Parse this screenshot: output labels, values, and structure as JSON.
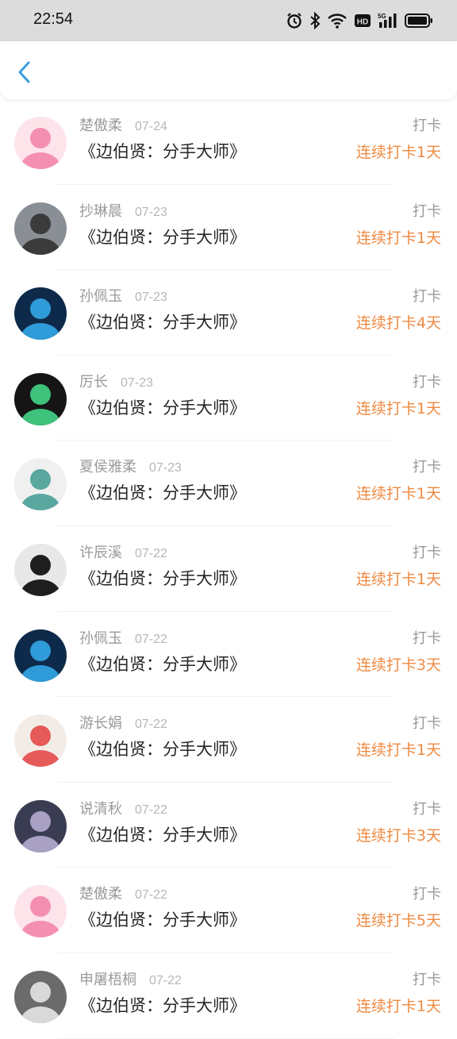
{
  "status_bar": {
    "time": "22:54",
    "icons": [
      "alarm-icon",
      "bluetooth-icon",
      "wifi-icon",
      "hd-icon",
      "5g-signal-icon",
      "battery-icon"
    ]
  },
  "nav": {
    "back_icon": "chevron-left-icon",
    "accent_color": "#3b9ee0"
  },
  "list": {
    "accent_color": "#ef8a42",
    "items": [
      {
        "user": "楚傲柔",
        "date": "07-24",
        "title": "《边伯贤：分手大师》",
        "action": "打卡",
        "streak": "连续打卡1天",
        "avatar": {
          "bg": "#fde3ea",
          "fg": "#f48fb1"
        }
      },
      {
        "user": "抄琳晨",
        "date": "07-23",
        "title": "《边伯贤：分手大师》",
        "action": "打卡",
        "streak": "连续打卡1天",
        "avatar": {
          "bg": "#8a8f95",
          "fg": "#3b3b3b"
        }
      },
      {
        "user": "孙佩玉",
        "date": "07-23",
        "title": "《边伯贤：分手大师》",
        "action": "打卡",
        "streak": "连续打卡4天",
        "avatar": {
          "bg": "#0e2a4a",
          "fg": "#2f9bd8"
        }
      },
      {
        "user": "厉长",
        "date": "07-23",
        "title": "《边伯贤：分手大师》",
        "action": "打卡",
        "streak": "连续打卡1天",
        "avatar": {
          "bg": "#151515",
          "fg": "#3fc27c"
        }
      },
      {
        "user": "夏侯雅柔",
        "date": "07-23",
        "title": "《边伯贤：分手大师》",
        "action": "打卡",
        "streak": "连续打卡1天",
        "avatar": {
          "bg": "#f0f0f0",
          "fg": "#5aa7a0"
        }
      },
      {
        "user": "许辰溪",
        "date": "07-22",
        "title": "《边伯贤：分手大师》",
        "action": "打卡",
        "streak": "连续打卡1天",
        "avatar": {
          "bg": "#e8e8e8",
          "fg": "#1e1e1e"
        }
      },
      {
        "user": "孙佩玉",
        "date": "07-22",
        "title": "《边伯贤：分手大师》",
        "action": "打卡",
        "streak": "连续打卡3天",
        "avatar": {
          "bg": "#0e2a4a",
          "fg": "#2f9bd8"
        }
      },
      {
        "user": "游长娟",
        "date": "07-22",
        "title": "《边伯贤：分手大师》",
        "action": "打卡",
        "streak": "连续打卡1天",
        "avatar": {
          "bg": "#f3ece6",
          "fg": "#e65a5a"
        }
      },
      {
        "user": "说清秋",
        "date": "07-22",
        "title": "《边伯贤：分手大师》",
        "action": "打卡",
        "streak": "连续打卡3天",
        "avatar": {
          "bg": "#3a3d52",
          "fg": "#a9a1c4"
        }
      },
      {
        "user": "楚傲柔",
        "date": "07-22",
        "title": "《边伯贤：分手大师》",
        "action": "打卡",
        "streak": "连续打卡5天",
        "avatar": {
          "bg": "#fde3ea",
          "fg": "#f48fb1"
        }
      },
      {
        "user": "申屠梧桐",
        "date": "07-22",
        "title": "《边伯贤：分手大师》",
        "action": "打卡",
        "streak": "连续打卡1天",
        "avatar": {
          "bg": "#6b6b6b",
          "fg": "#d9d9d9"
        }
      }
    ]
  }
}
